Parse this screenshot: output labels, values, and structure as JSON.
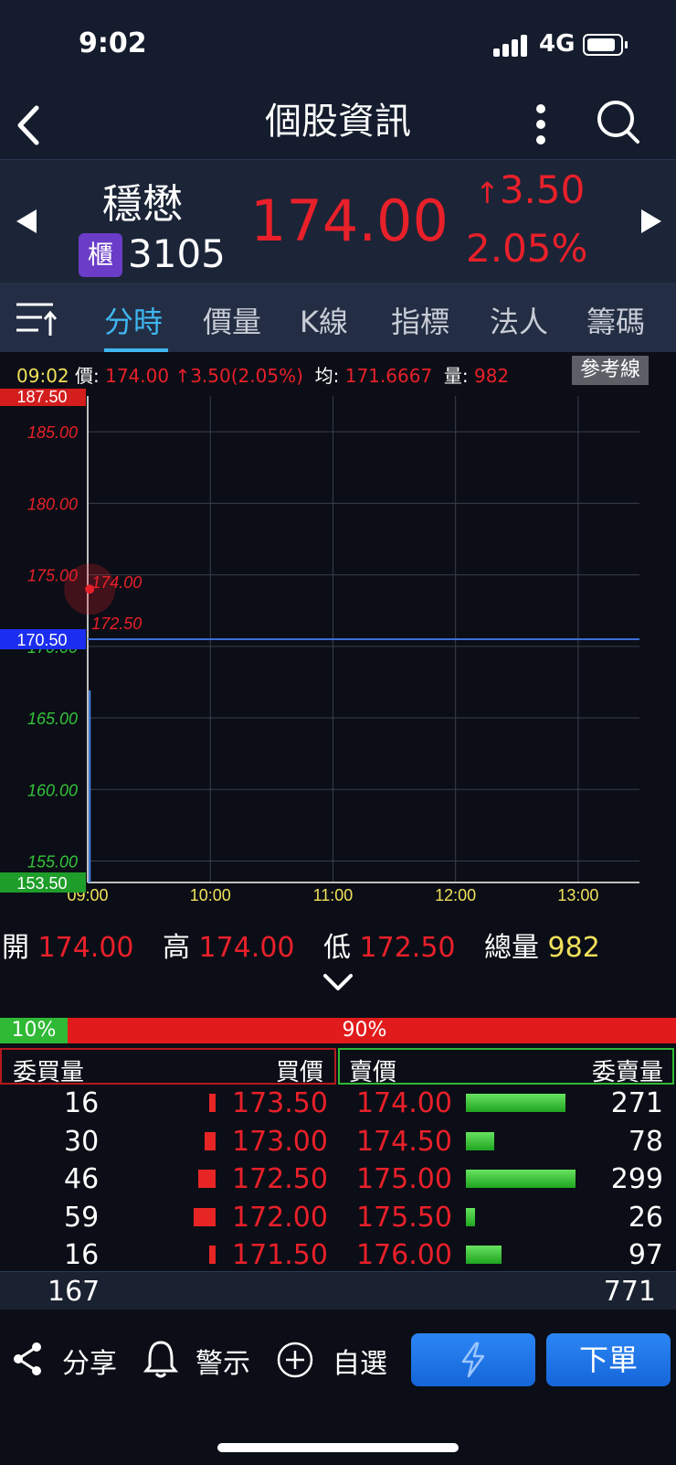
{
  "status": {
    "time": "9:02",
    "network": "4G"
  },
  "nav": {
    "back_icon": "chevron-left-icon",
    "title": "個股資訊"
  },
  "quote": {
    "name": "穩懋",
    "market_badge": "櫃",
    "code": "3105",
    "price": "174.00",
    "change": "3.50",
    "change_arrow": "↑",
    "change_pct": "2.05%"
  },
  "tabs": {
    "items": [
      "分時",
      "價量",
      "K線",
      "指標",
      "法人",
      "籌碼"
    ],
    "active": 0
  },
  "info_bar": {
    "time": "09:02",
    "price_label": "價:",
    "price": "174.00",
    "change": "↑3.50(2.05%)",
    "avg_label": "均:",
    "avg": "171.6667",
    "vol_label": "量:",
    "vol": "982",
    "ref_button": "參考線"
  },
  "chart_data": {
    "type": "line",
    "y_ticks": [
      "185.00",
      "180.00",
      "175.00",
      "170.00",
      "165.00",
      "160.00",
      "155.00"
    ],
    "x_ticks": [
      "09:00",
      "10:00",
      "11:00",
      "12:00",
      "13:00"
    ],
    "y_high_label": "187.50",
    "y_ref_label": "170.50",
    "y_low_label": "153.50",
    "ylim": [
      153.5,
      187.5
    ],
    "reference": 170.5,
    "point_high_label": "174.00",
    "point_low_label": "172.50",
    "price_points": [
      {
        "x": "09:01",
        "y": 174.0
      }
    ],
    "volume": [
      {
        "x": "09:01",
        "v": 982
      }
    ]
  },
  "ohlc": {
    "open_label": "開",
    "open": "174.00",
    "high_label": "高",
    "high": "174.00",
    "low_label": "低",
    "low": "172.50",
    "vol_label": "總量",
    "vol": "982"
  },
  "ratio": {
    "buy": "10%",
    "sell": "90%",
    "buy_fraction": 0.1
  },
  "book": {
    "headers": {
      "buy_qty": "委買量",
      "buy_price": "買價",
      "sell_price": "賣價",
      "sell_qty": "委賣量"
    },
    "rows": [
      {
        "buy_qty": "16",
        "buy_price": "173.50",
        "sell_price": "174.00",
        "sell_qty": "271"
      },
      {
        "buy_qty": "30",
        "buy_price": "173.00",
        "sell_price": "174.50",
        "sell_qty": "78"
      },
      {
        "buy_qty": "46",
        "buy_price": "172.50",
        "sell_price": "175.00",
        "sell_qty": "299"
      },
      {
        "buy_qty": "59",
        "buy_price": "172.00",
        "sell_price": "175.50",
        "sell_qty": "26"
      },
      {
        "buy_qty": "16",
        "buy_price": "171.50",
        "sell_price": "176.00",
        "sell_qty": "97"
      }
    ],
    "buy_total": "167",
    "sell_total": "771"
  },
  "bottom": {
    "share": "分享",
    "alert": "警示",
    "watch": "自選",
    "order": "下單"
  },
  "colors": {
    "up": "#e8202a",
    "down": "#34c33b",
    "accent": "#3fb6f0"
  }
}
